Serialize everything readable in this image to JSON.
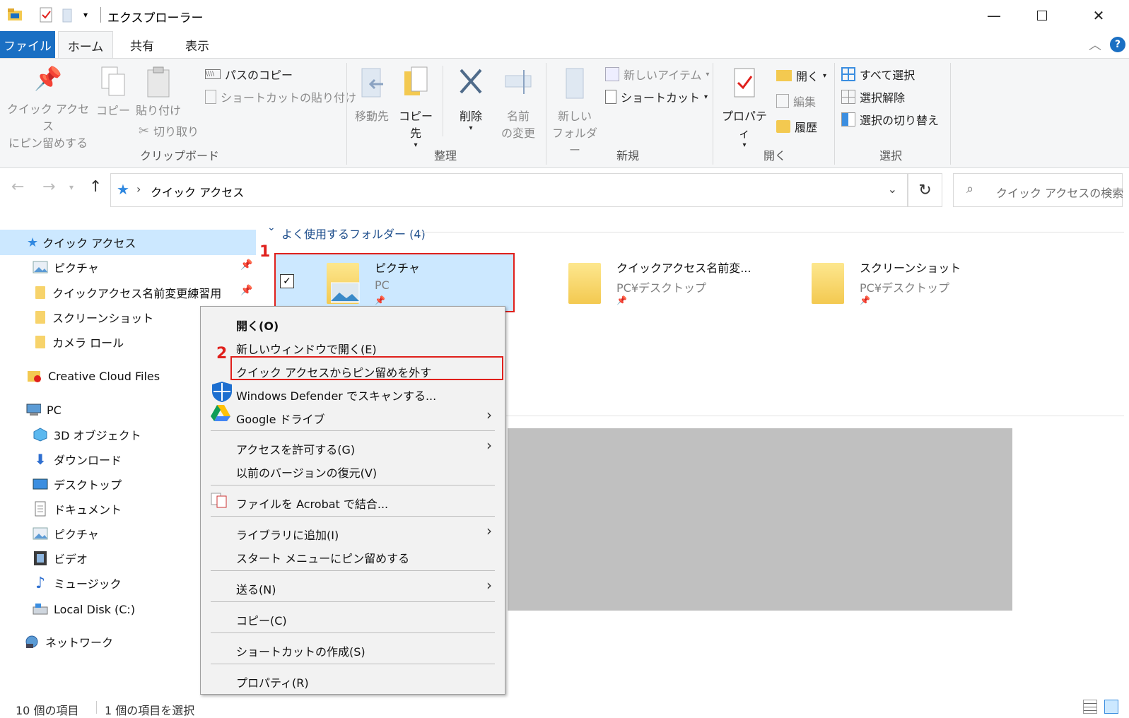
{
  "window": {
    "title": "エクスプローラー"
  },
  "tabs": [
    "ファイル",
    "ホーム",
    "共有",
    "表示"
  ],
  "ribbon": {
    "clipboard": {
      "pin": "クイック アクセス\nにピン留めする",
      "copy": "コピー",
      "paste": "貼り付け",
      "copy_path": "パスのコピー",
      "paste_shortcut": "ショートカットの貼り付け",
      "cut": "切り取り",
      "label": "クリップボード"
    },
    "organize": {
      "move": "移動先",
      "copy_to": "コピー先",
      "delete": "削除",
      "rename_1": "名前",
      "rename_2": "の変更",
      "label": "整理"
    },
    "new": {
      "new_folder_1": "新しい",
      "new_folder_2": "フォルダー",
      "new_item": "新しいアイテム",
      "shortcut": "ショートカット",
      "label": "新規"
    },
    "open": {
      "properties": "プロパティ",
      "open": "開く",
      "edit": "編集",
      "history": "履歴",
      "label": "開く"
    },
    "select": {
      "select_all": "すべて選択",
      "select_none": "選択解除",
      "invert": "選択の切り替え",
      "label": "選択"
    }
  },
  "address": {
    "path": "クイック アクセス",
    "search_placeholder": "クイック アクセスの検索"
  },
  "nav": {
    "quick_access": "クイック アクセス",
    "items": [
      "ピクチャ",
      "クイックアクセス名前変更練習用",
      "スクリーンショット",
      "カメラ ロール"
    ],
    "creative_cloud": "Creative Cloud Files",
    "pc": "PC",
    "pc_items": [
      "3D オブジェクト",
      "ダウンロード",
      "デスクトップ",
      "ドキュメント",
      "ピクチャ",
      "ビデオ",
      "ミュージック",
      "Local Disk (C:)"
    ],
    "network": "ネットワーク"
  },
  "content": {
    "group_header": "よく使用するフォルダー (4)",
    "folders": [
      {
        "name": "ピクチャ",
        "path": "PC"
      },
      {
        "name": "クイックアクセス名前変...",
        "path": "PC¥デスクトップ"
      },
      {
        "name": "スクリーンショット",
        "path": "PC¥デスクトップ"
      }
    ]
  },
  "context_menu": {
    "items": [
      "開く(O)",
      "新しいウィンドウで開く(E)",
      "クイック アクセスからピン留めを外す",
      "Windows Defender でスキャンする...",
      "Google ドライブ",
      "アクセスを許可する(G)",
      "以前のバージョンの復元(V)",
      "ファイルを Acrobat で結合...",
      "ライブラリに追加(I)",
      "スタート メニューにピン留めする",
      "送る(N)",
      "コピー(C)",
      "ショートカットの作成(S)",
      "プロパティ(R)"
    ]
  },
  "annotations": [
    "1",
    "2"
  ],
  "status": {
    "count": "10 個の項目",
    "selected": "1 個の項目を選択"
  },
  "colors": {
    "accent": "#1a6fc3",
    "selection": "#cce8ff",
    "highlight_box": "#e0201c",
    "folder": "#f7d36b"
  }
}
